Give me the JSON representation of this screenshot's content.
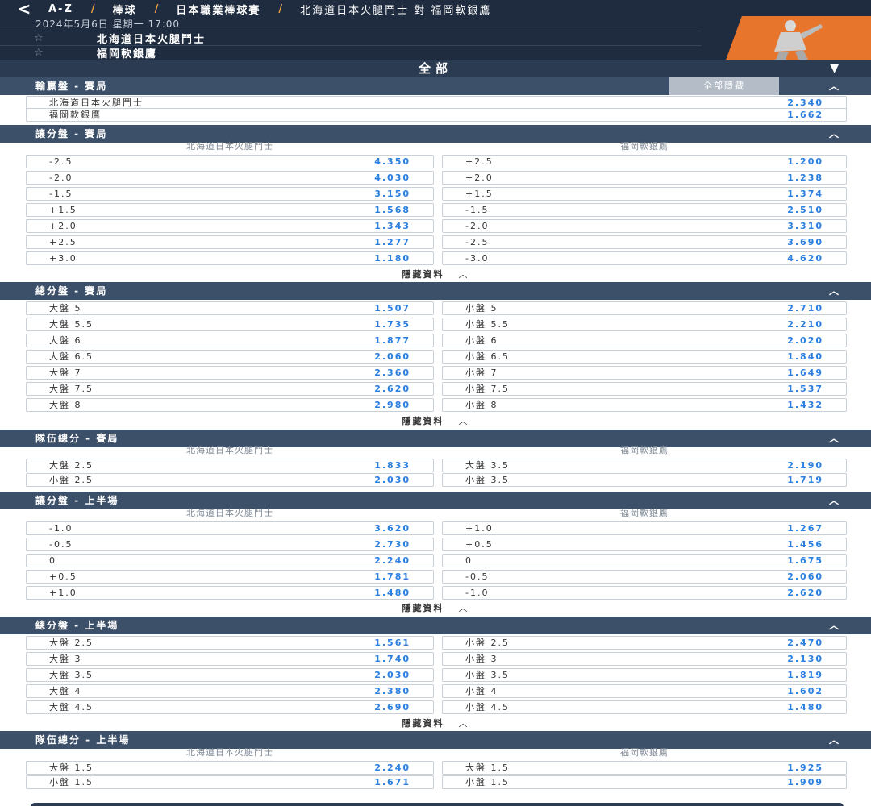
{
  "header": {
    "back_glyph": "<",
    "crumbs": [
      "A-Z",
      "棒球",
      "日本職業棒球賽"
    ],
    "crumb_sep": "/",
    "match_title": "北海道日本火腿鬥士 對 福岡軟銀鷹",
    "datetime": "2024年5月6日 星期一 17:00",
    "team_home": "北海道日本火腿鬥士",
    "team_away": "福岡軟銀鷹",
    "star_glyph": "☆"
  },
  "all_bar": {
    "label": "全部",
    "caret": "▼"
  },
  "hide_all_label": "全部隱藏",
  "hide_info_label": "隱藏資料",
  "up_glyph": "︿",
  "colors": {
    "odds": "#2a7fe0",
    "header_bg": "#1f2c3f",
    "section_bg": "#3c5069",
    "accent": "#e8752c"
  },
  "sections": {
    "moneyline_full": {
      "title": "輸贏盤 - 賽局",
      "rows": [
        {
          "label": "北海道日本火腿鬥士",
          "odds": "2.340"
        },
        {
          "label": "福岡軟銀鷹",
          "odds": "1.662"
        }
      ]
    },
    "handicap_full": {
      "title": "讓分盤 - 賽局",
      "col_home": "北海道日本火腿鬥士",
      "col_away": "福岡軟銀鷹",
      "rows": [
        {
          "home_label": "-2.5",
          "home_odds": "4.350",
          "away_label": "+2.5",
          "away_odds": "1.200"
        },
        {
          "home_label": "-2.0",
          "home_odds": "4.030",
          "away_label": "+2.0",
          "away_odds": "1.238"
        },
        {
          "home_label": "-1.5",
          "home_odds": "3.150",
          "away_label": "+1.5",
          "away_odds": "1.374"
        },
        {
          "home_label": "+1.5",
          "home_odds": "1.568",
          "away_label": "-1.5",
          "away_odds": "2.510"
        },
        {
          "home_label": "+2.0",
          "home_odds": "1.343",
          "away_label": "-2.0",
          "away_odds": "3.310"
        },
        {
          "home_label": "+2.5",
          "home_odds": "1.277",
          "away_label": "-2.5",
          "away_odds": "3.690"
        },
        {
          "home_label": "+3.0",
          "home_odds": "1.180",
          "away_label": "-3.0",
          "away_odds": "4.620"
        }
      ]
    },
    "total_full": {
      "title": "總分盤 - 賽局",
      "rows": [
        {
          "home_label": "大盤 5",
          "home_odds": "1.507",
          "away_label": "小盤 5",
          "away_odds": "2.710"
        },
        {
          "home_label": "大盤 5.5",
          "home_odds": "1.735",
          "away_label": "小盤 5.5",
          "away_odds": "2.210"
        },
        {
          "home_label": "大盤 6",
          "home_odds": "1.877",
          "away_label": "小盤 6",
          "away_odds": "2.020"
        },
        {
          "home_label": "大盤 6.5",
          "home_odds": "2.060",
          "away_label": "小盤 6.5",
          "away_odds": "1.840"
        },
        {
          "home_label": "大盤 7",
          "home_odds": "2.360",
          "away_label": "小盤 7",
          "away_odds": "1.649"
        },
        {
          "home_label": "大盤 7.5",
          "home_odds": "2.620",
          "away_label": "小盤 7.5",
          "away_odds": "1.537"
        },
        {
          "home_label": "大盤 8",
          "home_odds": "2.980",
          "away_label": "小盤 8",
          "away_odds": "1.432"
        }
      ]
    },
    "team_total_full": {
      "title": "隊伍總分 - 賽局",
      "col_home": "北海道日本火腿鬥士",
      "col_away": "福岡軟銀鷹",
      "rows": [
        {
          "home_label": "大盤 2.5",
          "home_odds": "1.833",
          "away_label": "大盤 3.5",
          "away_odds": "2.190"
        },
        {
          "home_label": "小盤 2.5",
          "home_odds": "2.030",
          "away_label": "小盤 3.5",
          "away_odds": "1.719"
        }
      ]
    },
    "handicap_half": {
      "title": "讓分盤 - 上半場",
      "col_home": "北海道日本火腿鬥士",
      "col_away": "福岡軟銀鷹",
      "rows": [
        {
          "home_label": "-1.0",
          "home_odds": "3.620",
          "away_label": "+1.0",
          "away_odds": "1.267"
        },
        {
          "home_label": "-0.5",
          "home_odds": "2.730",
          "away_label": "+0.5",
          "away_odds": "1.456"
        },
        {
          "home_label": "0",
          "home_odds": "2.240",
          "away_label": "0",
          "away_odds": "1.675"
        },
        {
          "home_label": "+0.5",
          "home_odds": "1.781",
          "away_label": "-0.5",
          "away_odds": "2.060"
        },
        {
          "home_label": "+1.0",
          "home_odds": "1.480",
          "away_label": "-1.0",
          "away_odds": "2.620"
        }
      ]
    },
    "total_half": {
      "title": "總分盤 - 上半場",
      "rows": [
        {
          "home_label": "大盤 2.5",
          "home_odds": "1.561",
          "away_label": "小盤 2.5",
          "away_odds": "2.470"
        },
        {
          "home_label": "大盤 3",
          "home_odds": "1.740",
          "away_label": "小盤 3",
          "away_odds": "2.130"
        },
        {
          "home_label": "大盤 3.5",
          "home_odds": "2.030",
          "away_label": "小盤 3.5",
          "away_odds": "1.819"
        },
        {
          "home_label": "大盤 4",
          "home_odds": "2.380",
          "away_label": "小盤 4",
          "away_odds": "1.602"
        },
        {
          "home_label": "大盤 4.5",
          "home_odds": "2.690",
          "away_label": "小盤 4.5",
          "away_odds": "1.480"
        }
      ]
    },
    "team_total_half": {
      "title": "隊伍總分 - 上半場",
      "col_home": "北海道日本火腿鬥士",
      "col_away": "福岡軟銀鷹",
      "rows": [
        {
          "home_label": "大盤 1.5",
          "home_odds": "2.240",
          "away_label": "大盤 1.5",
          "away_odds": "1.925"
        },
        {
          "home_label": "小盤 1.5",
          "home_odds": "1.671",
          "away_label": "小盤 1.5",
          "away_odds": "1.909"
        }
      ]
    }
  }
}
